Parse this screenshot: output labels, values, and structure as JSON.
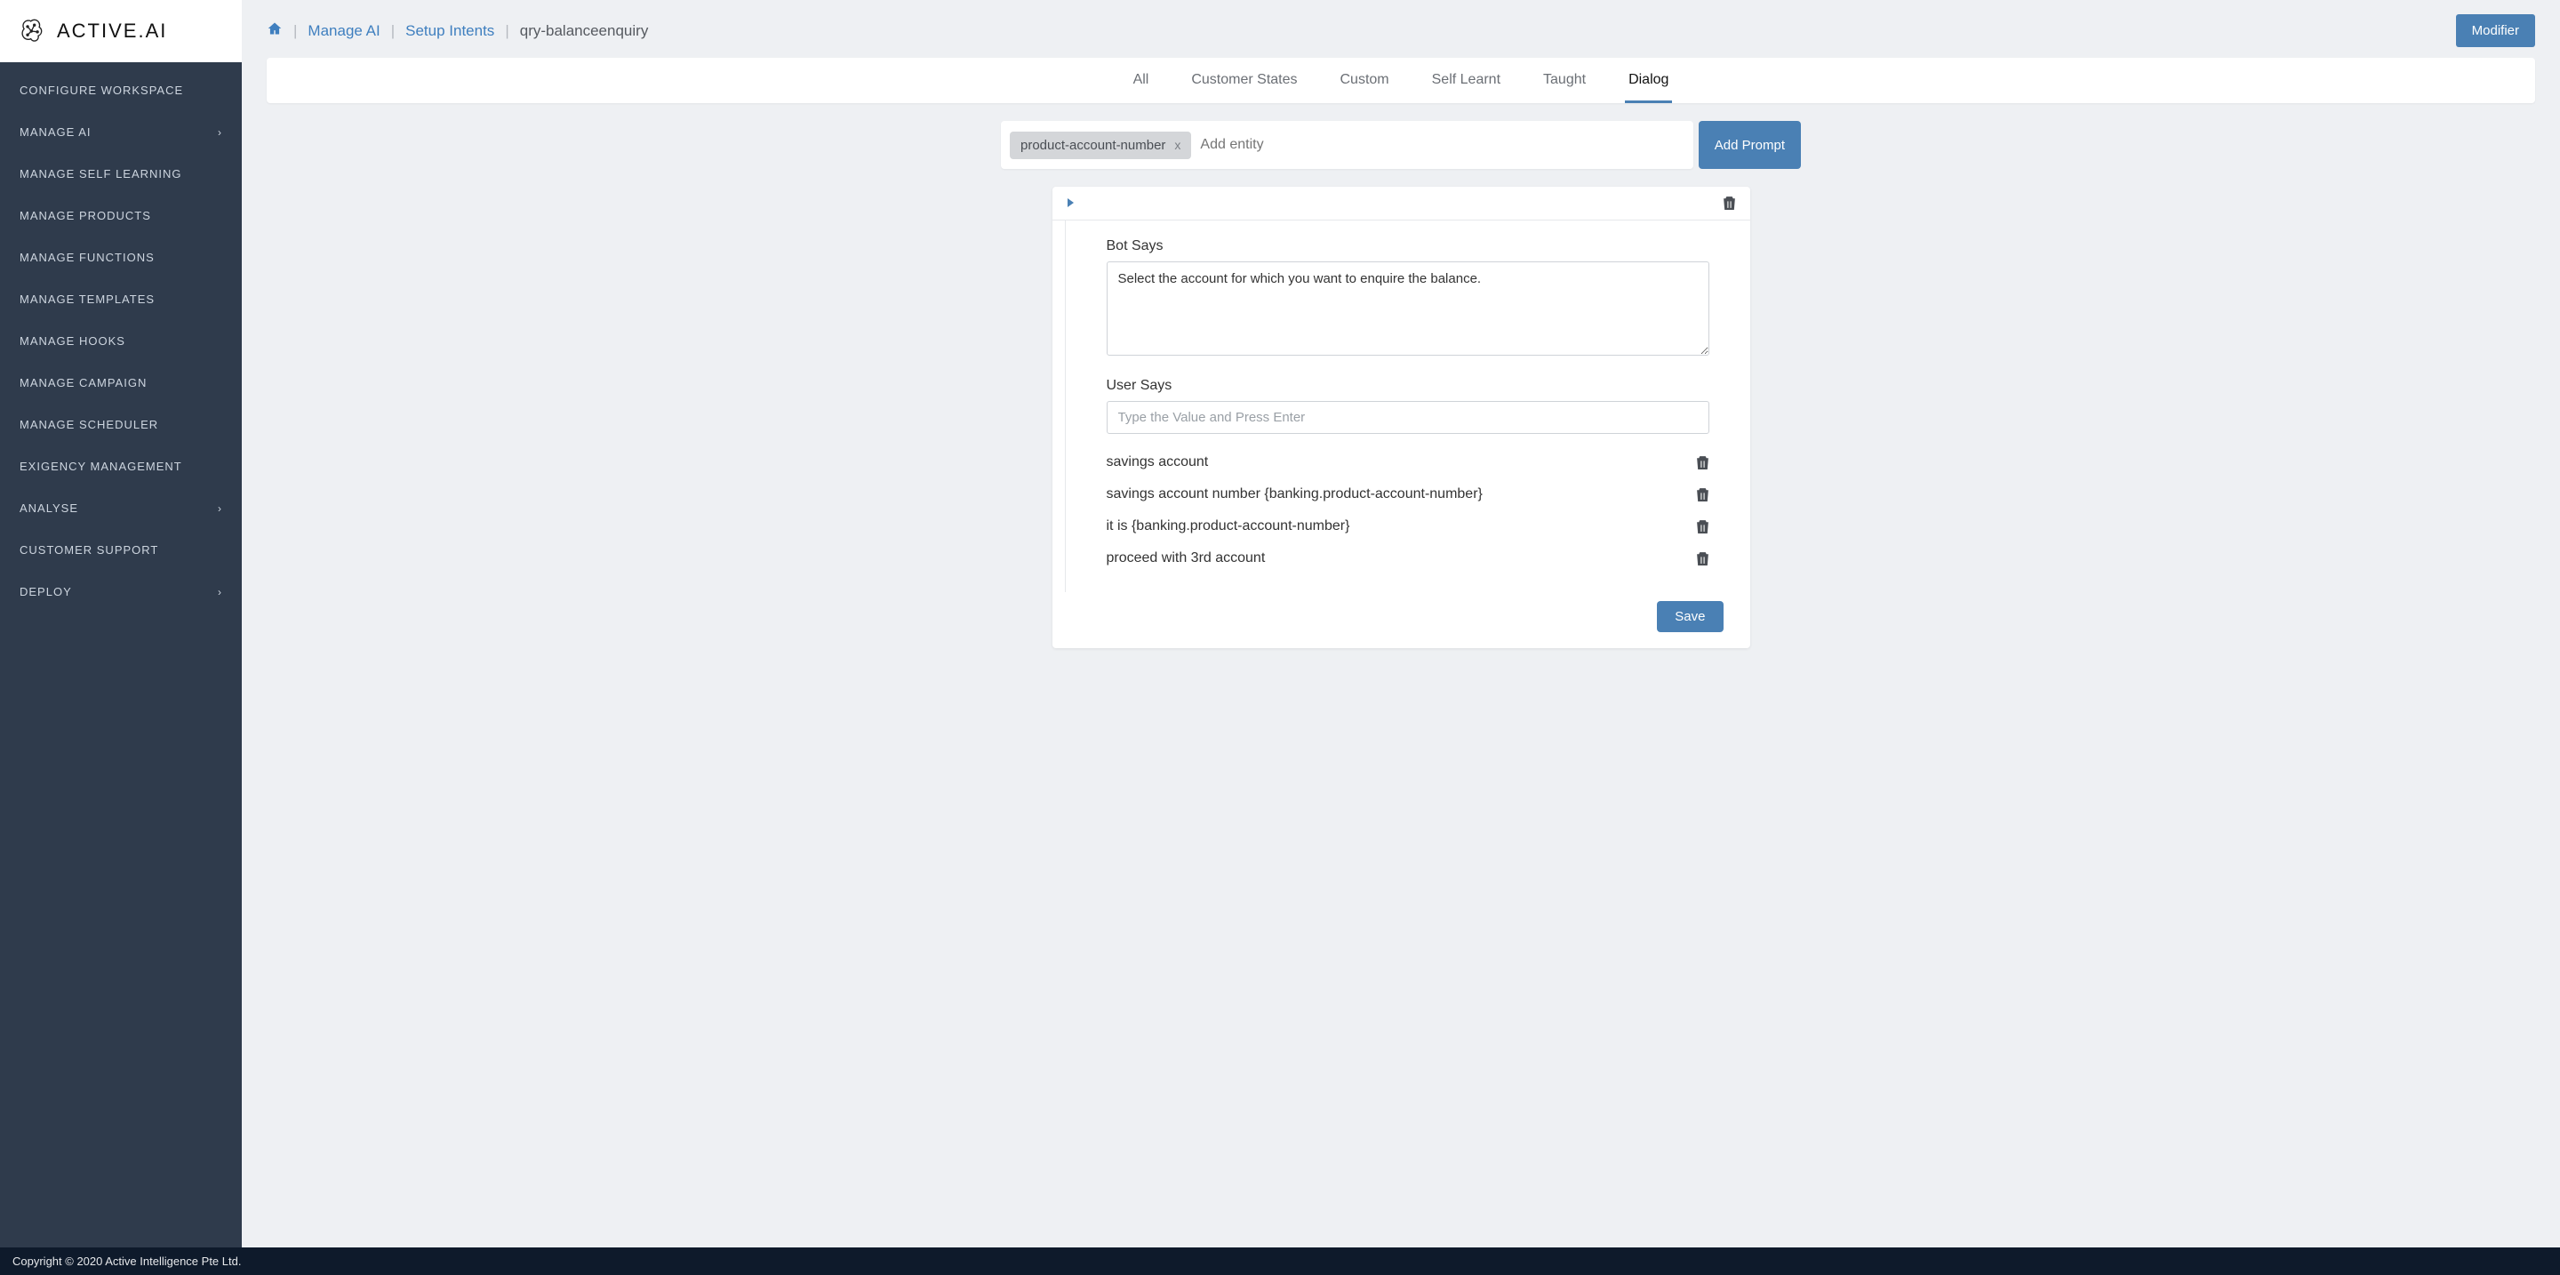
{
  "logo": {
    "text": "ACTIVE.AI"
  },
  "sidebar": {
    "items": [
      {
        "label": "CONFIGURE WORKSPACE",
        "expandable": false
      },
      {
        "label": "MANAGE AI",
        "expandable": true
      },
      {
        "label": "MANAGE SELF LEARNING",
        "expandable": false
      },
      {
        "label": "MANAGE PRODUCTS",
        "expandable": false
      },
      {
        "label": "MANAGE FUNCTIONS",
        "expandable": false
      },
      {
        "label": "MANAGE TEMPLATES",
        "expandable": false
      },
      {
        "label": "MANAGE HOOKS",
        "expandable": false
      },
      {
        "label": "MANAGE CAMPAIGN",
        "expandable": false
      },
      {
        "label": "MANAGE SCHEDULER",
        "expandable": false
      },
      {
        "label": "EXIGENCY MANAGEMENT",
        "expandable": false
      },
      {
        "label": "ANALYSE",
        "expandable": true
      },
      {
        "label": "CUSTOMER SUPPORT",
        "expandable": false
      },
      {
        "label": "DEPLOY",
        "expandable": true
      }
    ]
  },
  "breadcrumb": {
    "links": [
      "Manage AI",
      "Setup Intents"
    ],
    "current": "qry-balanceenquiry"
  },
  "modifier_label": "Modifier",
  "tabs": [
    {
      "label": "All",
      "active": false
    },
    {
      "label": "Customer States",
      "active": false
    },
    {
      "label": "Custom",
      "active": false
    },
    {
      "label": "Self Learnt",
      "active": false
    },
    {
      "label": "Taught",
      "active": false
    },
    {
      "label": "Dialog",
      "active": true
    }
  ],
  "entity_chip": "product-account-number",
  "entity_placeholder": "Add entity",
  "add_prompt_label": "Add Prompt",
  "dialog": {
    "bot_says_label": "Bot Says",
    "bot_says_value": "Select the account for which you want to enquire the balance.",
    "user_says_label": "User Says",
    "user_says_placeholder": "Type the Value and Press Enter",
    "utterances": [
      "savings account",
      "savings account number {banking.product-account-number}",
      "it is {banking.product-account-number}",
      "proceed with 3rd account"
    ],
    "save_label": "Save"
  },
  "footer": "Copyright © 2020 Active Intelligence Pte Ltd."
}
